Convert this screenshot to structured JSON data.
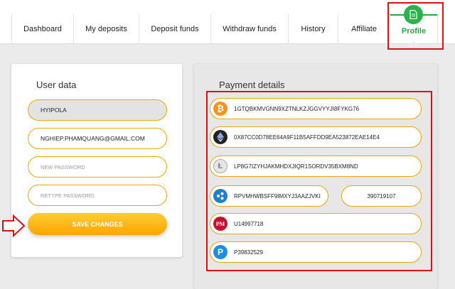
{
  "nav": {
    "tabs": [
      "Dashboard",
      "My deposits",
      "Deposit funds",
      "Withdraw funds",
      "History",
      "Affiliate",
      "Profile"
    ],
    "active": "Profile"
  },
  "user": {
    "title": "User data",
    "username": "HYIPOLA",
    "email": "NGHIEP.PHAMQUANG@GMAIL.COM",
    "new_password_placeholder": "NEW PASSWORD",
    "retype_password_placeholder": "RETYPE PASSWORD",
    "save_label": "SAVE CHANGES"
  },
  "payment": {
    "title": "Payment details",
    "bitcoin": "1GTQBKMVGNN9XZTNLKZJGGVYYJI8FYKG76",
    "ethereum": "0X87CC0D78EE64A9F11B5AFFDD9EA523872EAE14E4",
    "litecoin": "LP8G7IZYHJAKMHDXJIQR1SORDV35BXM8ND",
    "ripple": "RPVMHWBSFF9IMXYJ3AAZJVKI",
    "ripple_tag": "390719107",
    "perfectmoney": "U14997718",
    "payeer": "P39832529"
  },
  "icons": {
    "bitcoin": "bitcoin-icon",
    "ethereum": "ethereum-icon",
    "litecoin": "litecoin-icon",
    "ripple": "ripple-icon",
    "perfectmoney": "perfectmoney-icon",
    "payeer": "payeer-icon",
    "profile": "document-icon"
  },
  "colors": {
    "accent_green": "#2bb14d",
    "accent_orange": "#f0a500",
    "highlight_red": "#e01010"
  }
}
